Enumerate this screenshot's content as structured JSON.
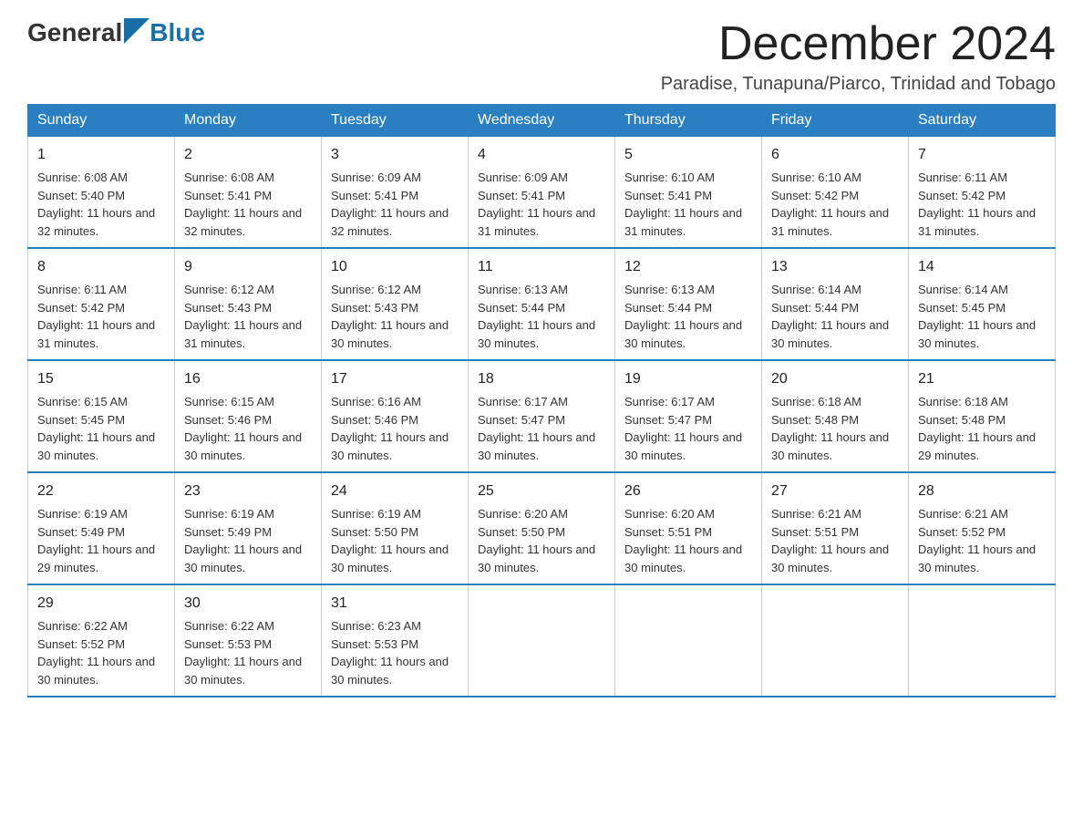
{
  "header": {
    "logo": {
      "general": "General",
      "blue": "Blue"
    },
    "title": "December 2024",
    "location": "Paradise, Tunapuna/Piarco, Trinidad and Tobago"
  },
  "weekdays": [
    "Sunday",
    "Monday",
    "Tuesday",
    "Wednesday",
    "Thursday",
    "Friday",
    "Saturday"
  ],
  "weeks": [
    [
      {
        "day": "1",
        "sunrise": "Sunrise: 6:08 AM",
        "sunset": "Sunset: 5:40 PM",
        "daylight": "Daylight: 11 hours and 32 minutes."
      },
      {
        "day": "2",
        "sunrise": "Sunrise: 6:08 AM",
        "sunset": "Sunset: 5:41 PM",
        "daylight": "Daylight: 11 hours and 32 minutes."
      },
      {
        "day": "3",
        "sunrise": "Sunrise: 6:09 AM",
        "sunset": "Sunset: 5:41 PM",
        "daylight": "Daylight: 11 hours and 32 minutes."
      },
      {
        "day": "4",
        "sunrise": "Sunrise: 6:09 AM",
        "sunset": "Sunset: 5:41 PM",
        "daylight": "Daylight: 11 hours and 31 minutes."
      },
      {
        "day": "5",
        "sunrise": "Sunrise: 6:10 AM",
        "sunset": "Sunset: 5:41 PM",
        "daylight": "Daylight: 11 hours and 31 minutes."
      },
      {
        "day": "6",
        "sunrise": "Sunrise: 6:10 AM",
        "sunset": "Sunset: 5:42 PM",
        "daylight": "Daylight: 11 hours and 31 minutes."
      },
      {
        "day": "7",
        "sunrise": "Sunrise: 6:11 AM",
        "sunset": "Sunset: 5:42 PM",
        "daylight": "Daylight: 11 hours and 31 minutes."
      }
    ],
    [
      {
        "day": "8",
        "sunrise": "Sunrise: 6:11 AM",
        "sunset": "Sunset: 5:42 PM",
        "daylight": "Daylight: 11 hours and 31 minutes."
      },
      {
        "day": "9",
        "sunrise": "Sunrise: 6:12 AM",
        "sunset": "Sunset: 5:43 PM",
        "daylight": "Daylight: 11 hours and 31 minutes."
      },
      {
        "day": "10",
        "sunrise": "Sunrise: 6:12 AM",
        "sunset": "Sunset: 5:43 PM",
        "daylight": "Daylight: 11 hours and 30 minutes."
      },
      {
        "day": "11",
        "sunrise": "Sunrise: 6:13 AM",
        "sunset": "Sunset: 5:44 PM",
        "daylight": "Daylight: 11 hours and 30 minutes."
      },
      {
        "day": "12",
        "sunrise": "Sunrise: 6:13 AM",
        "sunset": "Sunset: 5:44 PM",
        "daylight": "Daylight: 11 hours and 30 minutes."
      },
      {
        "day": "13",
        "sunrise": "Sunrise: 6:14 AM",
        "sunset": "Sunset: 5:44 PM",
        "daylight": "Daylight: 11 hours and 30 minutes."
      },
      {
        "day": "14",
        "sunrise": "Sunrise: 6:14 AM",
        "sunset": "Sunset: 5:45 PM",
        "daylight": "Daylight: 11 hours and 30 minutes."
      }
    ],
    [
      {
        "day": "15",
        "sunrise": "Sunrise: 6:15 AM",
        "sunset": "Sunset: 5:45 PM",
        "daylight": "Daylight: 11 hours and 30 minutes."
      },
      {
        "day": "16",
        "sunrise": "Sunrise: 6:15 AM",
        "sunset": "Sunset: 5:46 PM",
        "daylight": "Daylight: 11 hours and 30 minutes."
      },
      {
        "day": "17",
        "sunrise": "Sunrise: 6:16 AM",
        "sunset": "Sunset: 5:46 PM",
        "daylight": "Daylight: 11 hours and 30 minutes."
      },
      {
        "day": "18",
        "sunrise": "Sunrise: 6:17 AM",
        "sunset": "Sunset: 5:47 PM",
        "daylight": "Daylight: 11 hours and 30 minutes."
      },
      {
        "day": "19",
        "sunrise": "Sunrise: 6:17 AM",
        "sunset": "Sunset: 5:47 PM",
        "daylight": "Daylight: 11 hours and 30 minutes."
      },
      {
        "day": "20",
        "sunrise": "Sunrise: 6:18 AM",
        "sunset": "Sunset: 5:48 PM",
        "daylight": "Daylight: 11 hours and 30 minutes."
      },
      {
        "day": "21",
        "sunrise": "Sunrise: 6:18 AM",
        "sunset": "Sunset: 5:48 PM",
        "daylight": "Daylight: 11 hours and 29 minutes."
      }
    ],
    [
      {
        "day": "22",
        "sunrise": "Sunrise: 6:19 AM",
        "sunset": "Sunset: 5:49 PM",
        "daylight": "Daylight: 11 hours and 29 minutes."
      },
      {
        "day": "23",
        "sunrise": "Sunrise: 6:19 AM",
        "sunset": "Sunset: 5:49 PM",
        "daylight": "Daylight: 11 hours and 30 minutes."
      },
      {
        "day": "24",
        "sunrise": "Sunrise: 6:19 AM",
        "sunset": "Sunset: 5:50 PM",
        "daylight": "Daylight: 11 hours and 30 minutes."
      },
      {
        "day": "25",
        "sunrise": "Sunrise: 6:20 AM",
        "sunset": "Sunset: 5:50 PM",
        "daylight": "Daylight: 11 hours and 30 minutes."
      },
      {
        "day": "26",
        "sunrise": "Sunrise: 6:20 AM",
        "sunset": "Sunset: 5:51 PM",
        "daylight": "Daylight: 11 hours and 30 minutes."
      },
      {
        "day": "27",
        "sunrise": "Sunrise: 6:21 AM",
        "sunset": "Sunset: 5:51 PM",
        "daylight": "Daylight: 11 hours and 30 minutes."
      },
      {
        "day": "28",
        "sunrise": "Sunrise: 6:21 AM",
        "sunset": "Sunset: 5:52 PM",
        "daylight": "Daylight: 11 hours and 30 minutes."
      }
    ],
    [
      {
        "day": "29",
        "sunrise": "Sunrise: 6:22 AM",
        "sunset": "Sunset: 5:52 PM",
        "daylight": "Daylight: 11 hours and 30 minutes."
      },
      {
        "day": "30",
        "sunrise": "Sunrise: 6:22 AM",
        "sunset": "Sunset: 5:53 PM",
        "daylight": "Daylight: 11 hours and 30 minutes."
      },
      {
        "day": "31",
        "sunrise": "Sunrise: 6:23 AM",
        "sunset": "Sunset: 5:53 PM",
        "daylight": "Daylight: 11 hours and 30 minutes."
      },
      null,
      null,
      null,
      null
    ]
  ]
}
